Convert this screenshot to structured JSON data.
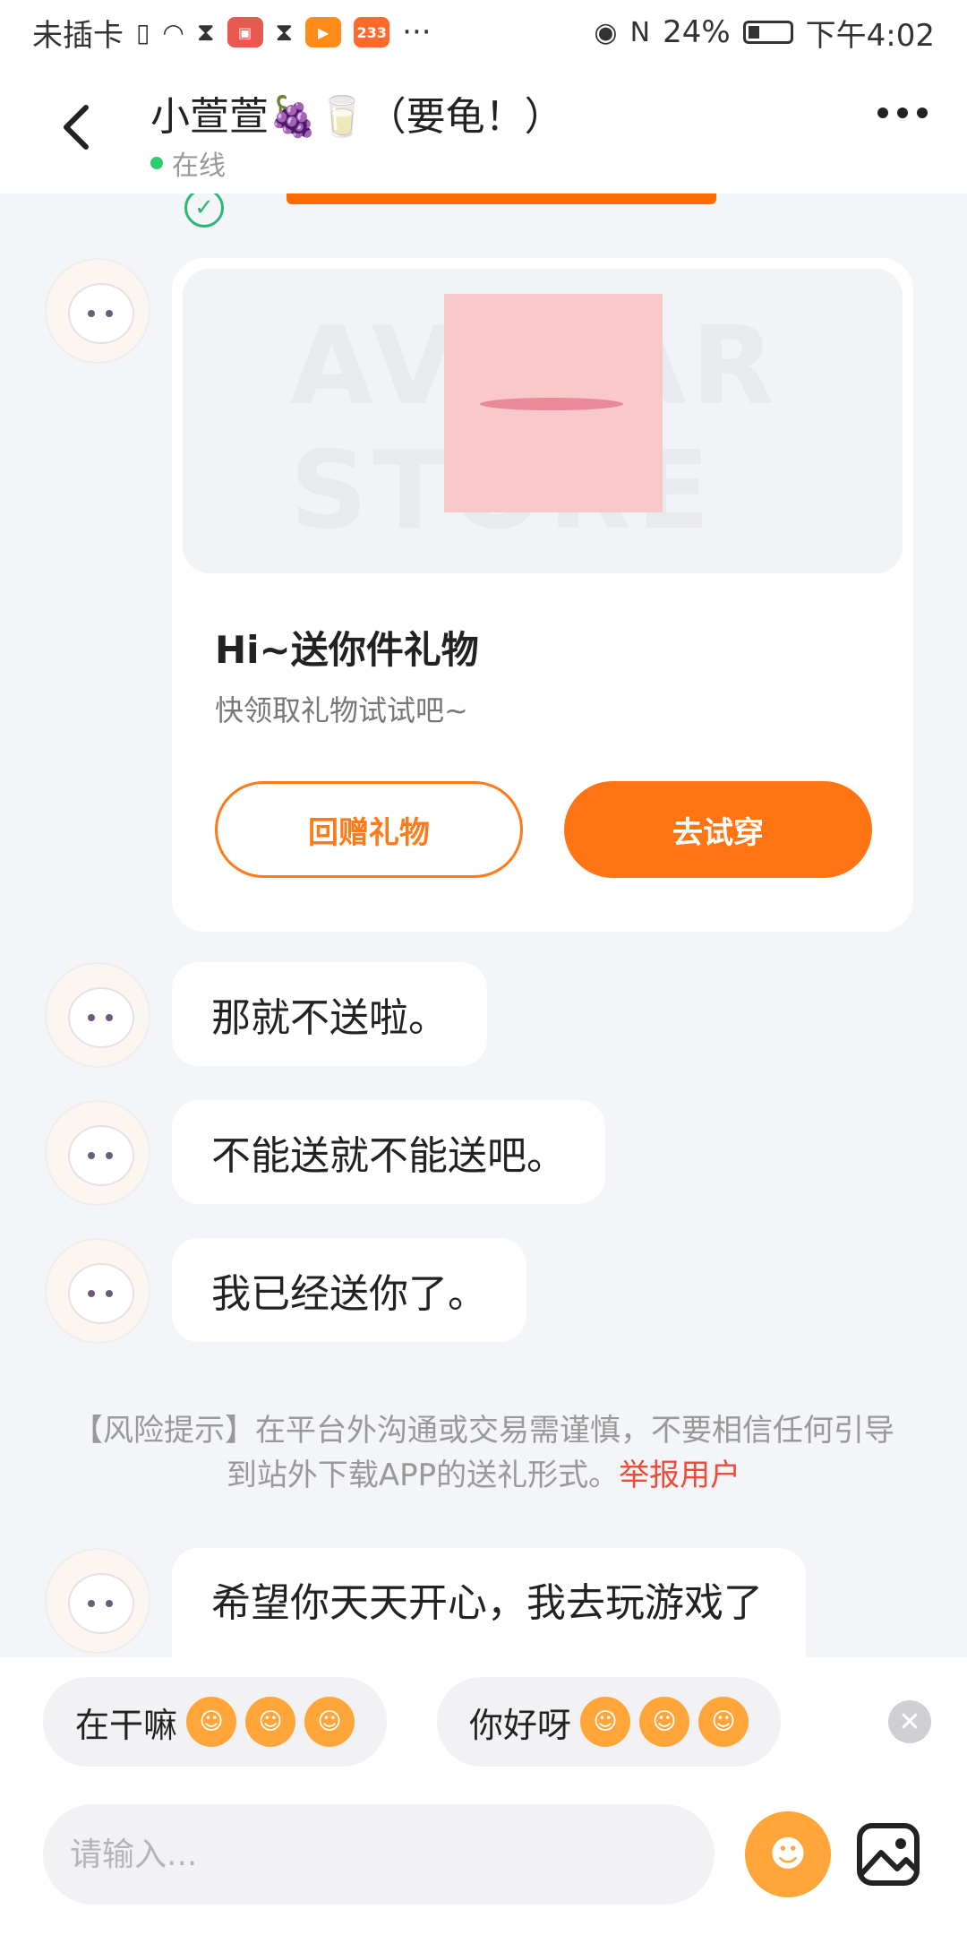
{
  "status_bar": {
    "carrier": "未插卡",
    "app_chip_233": "233",
    "more": "···",
    "battery": "24%",
    "time": "下午4:02"
  },
  "header": {
    "title": "小萱萱🍇🥛（要龟！）",
    "status": "在线"
  },
  "gift_card": {
    "title": "Hi~送你件礼物",
    "subtitle": "快领取礼物试试吧~",
    "watermark": "AVATAR STORE",
    "return_gift_label": "回赠礼物",
    "try_on_label": "去试穿"
  },
  "messages": [
    {
      "text": "那就不送啦。"
    },
    {
      "text": "不能送就不能送吧。"
    },
    {
      "text": "我已经送你了。"
    }
  ],
  "risk_notice": {
    "text": "【风险提示】在平台外沟通或交易需谨慎，不要相信任何引导到站外下载APP的送礼形式。",
    "report_link": "举报用户"
  },
  "last_message": {
    "text": "希望你天天开心，我去玩游戏了"
  },
  "quick_replies": [
    {
      "text": "在干嘛"
    },
    {
      "text": "你好呀"
    }
  ],
  "input": {
    "placeholder": "请输入..."
  },
  "colors": {
    "accent": "#ff7413",
    "online_dot": "#2ecc71",
    "report": "#ef4b3a",
    "background": "#f4f5f8"
  },
  "icons": [
    "back-icon",
    "more-icon",
    "check-icon",
    "close-icon",
    "mascot-icon",
    "image-icon",
    "wifi-icon",
    "eye-icon",
    "nfc-icon",
    "battery-icon"
  ]
}
